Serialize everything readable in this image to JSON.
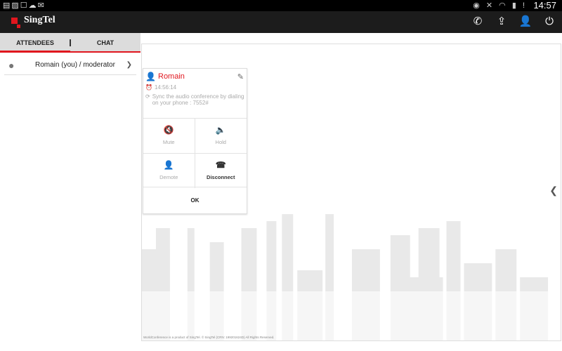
{
  "status": {
    "left_icons": "sim-icon image-icon cast-check-icon upload-cloud-icon mail-icon",
    "time": "14:57"
  },
  "app": {
    "brand": "SingTel"
  },
  "toolbar": {
    "icons": [
      "phone-call-icon",
      "upload-icon",
      "add-user-icon",
      "power-icon"
    ]
  },
  "tabs": [
    {
      "label": "ATTENDEES"
    },
    {
      "label": "CHAT"
    }
  ],
  "attendees": [
    {
      "name": "Romain (you) / moderator"
    }
  ],
  "card": {
    "name": "Romain",
    "time": "14:56:14",
    "sync": "Sync the audio conference by dialing on your phone : 7552#",
    "actions": [
      {
        "label": "Mute",
        "enabled": false
      },
      {
        "label": "Hold",
        "enabled": false
      },
      {
        "label": "Demote",
        "enabled": false
      },
      {
        "label": "Disconnect",
        "enabled": true
      }
    ],
    "ok": "OK"
  },
  "footer": "WorldConference is a product of SingTel. © SingTel (CRN: 199201624D) All Rights Reserved.",
  "colors": {
    "accent": "#e0161e",
    "appbar": "#1c1c1c"
  }
}
